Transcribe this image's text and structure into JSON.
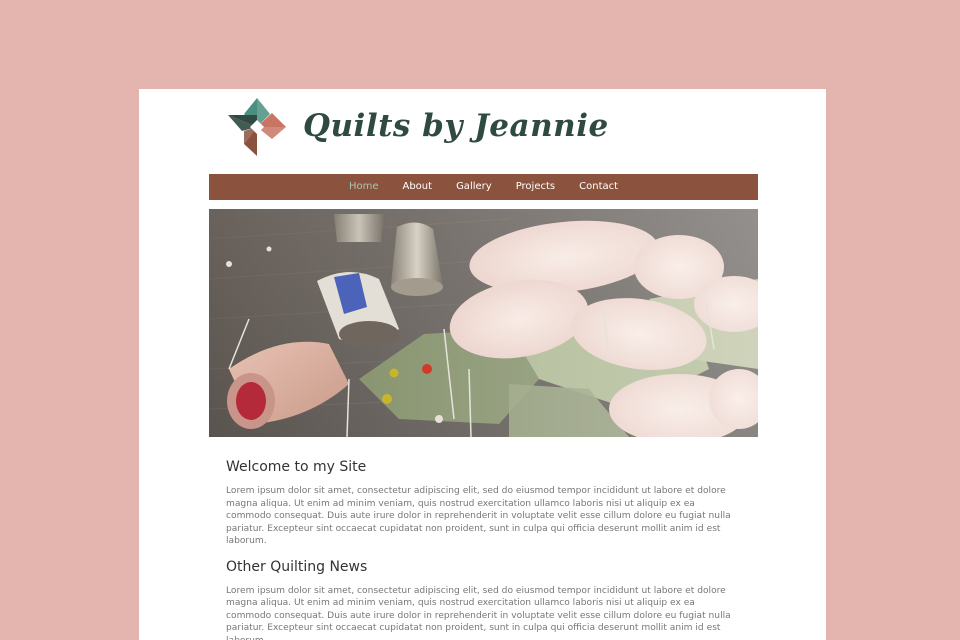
{
  "site": {
    "title": "Quilts by Jeannie"
  },
  "nav": {
    "items": [
      {
        "label": "Home",
        "active": true
      },
      {
        "label": "About",
        "active": false
      },
      {
        "label": "Gallery",
        "active": false
      },
      {
        "label": "Projects",
        "active": false
      },
      {
        "label": "Contact",
        "active": false
      }
    ]
  },
  "sections": [
    {
      "heading": "Welcome to my Site",
      "body": "Lorem ipsum dolor sit amet, consectetur adipiscing elit, sed do eiusmod tempor incididunt ut labore et dolore magna aliqua. Ut enim ad minim veniam, quis nostrud exercitation ullamco laboris nisi ut aliquip ex ea commodo consequat. Duis aute irure dolor in reprehenderit in voluptate velit esse cillum dolore eu fugiat nulla pariatur. Excepteur sint occaecat cupidatat non proident, sunt in culpa qui officia deserunt mollit anim id est laborum."
    },
    {
      "heading": "Other Quilting News",
      "body": "Lorem ipsum dolor sit amet, consectetur adipiscing elit, sed do eiusmod tempor incididunt ut labore et dolore magna aliqua. Ut enim ad minim veniam, quis nostrud exercitation ullamco laboris nisi ut aliquip ex ea commodo consequat. Duis aute irure dolor in reprehenderit in voluptate velit esse cillum dolore eu fugiat nulla pariatur. Excepteur sint occaecat cupidatat non proident, sunt in culpa qui officia deserunt mollit anim id est laborum."
    }
  ],
  "icons": {
    "logo": "quilt-pinwheel-logo-icon"
  },
  "colors": {
    "background": "#e4b5af",
    "page": "#ffffff",
    "nav_background": "#8b533e",
    "nav_active": "#a5c6b8",
    "title": "#2f4a40",
    "logo_teal": "#4a8f80",
    "logo_dark": "#2f4a40",
    "logo_coral": "#c97563",
    "logo_brown": "#8b533e"
  }
}
